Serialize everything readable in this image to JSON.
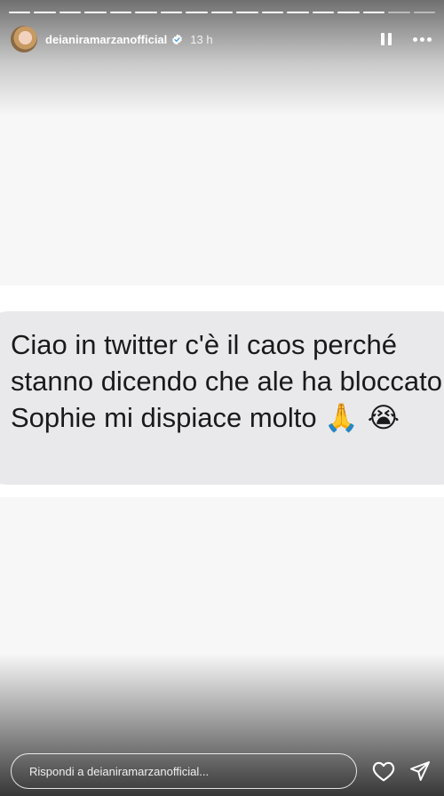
{
  "story": {
    "progress": {
      "total_segments": 17,
      "completed_segments": 15
    },
    "header": {
      "username": "deianiramarzanofficial",
      "verified": true,
      "time": "13 h"
    },
    "message": {
      "text": "Ciao in twitter c'è il caos perché stanno dicendo che ale ha bloccato Sophie mi dispiace molto",
      "emojis": "🙏 😭"
    },
    "footer": {
      "reply_placeholder": "Rispondi a deianiramarzanofficial..."
    },
    "icons": {
      "pause": "pause-icon",
      "more": "more-icon",
      "heart": "heart-icon",
      "send": "send-icon",
      "verified": "verified-badge-icon"
    },
    "colors": {
      "background": "#f7f7f7",
      "bubble": "#e9e9eb",
      "verified": "#3897f0"
    }
  }
}
